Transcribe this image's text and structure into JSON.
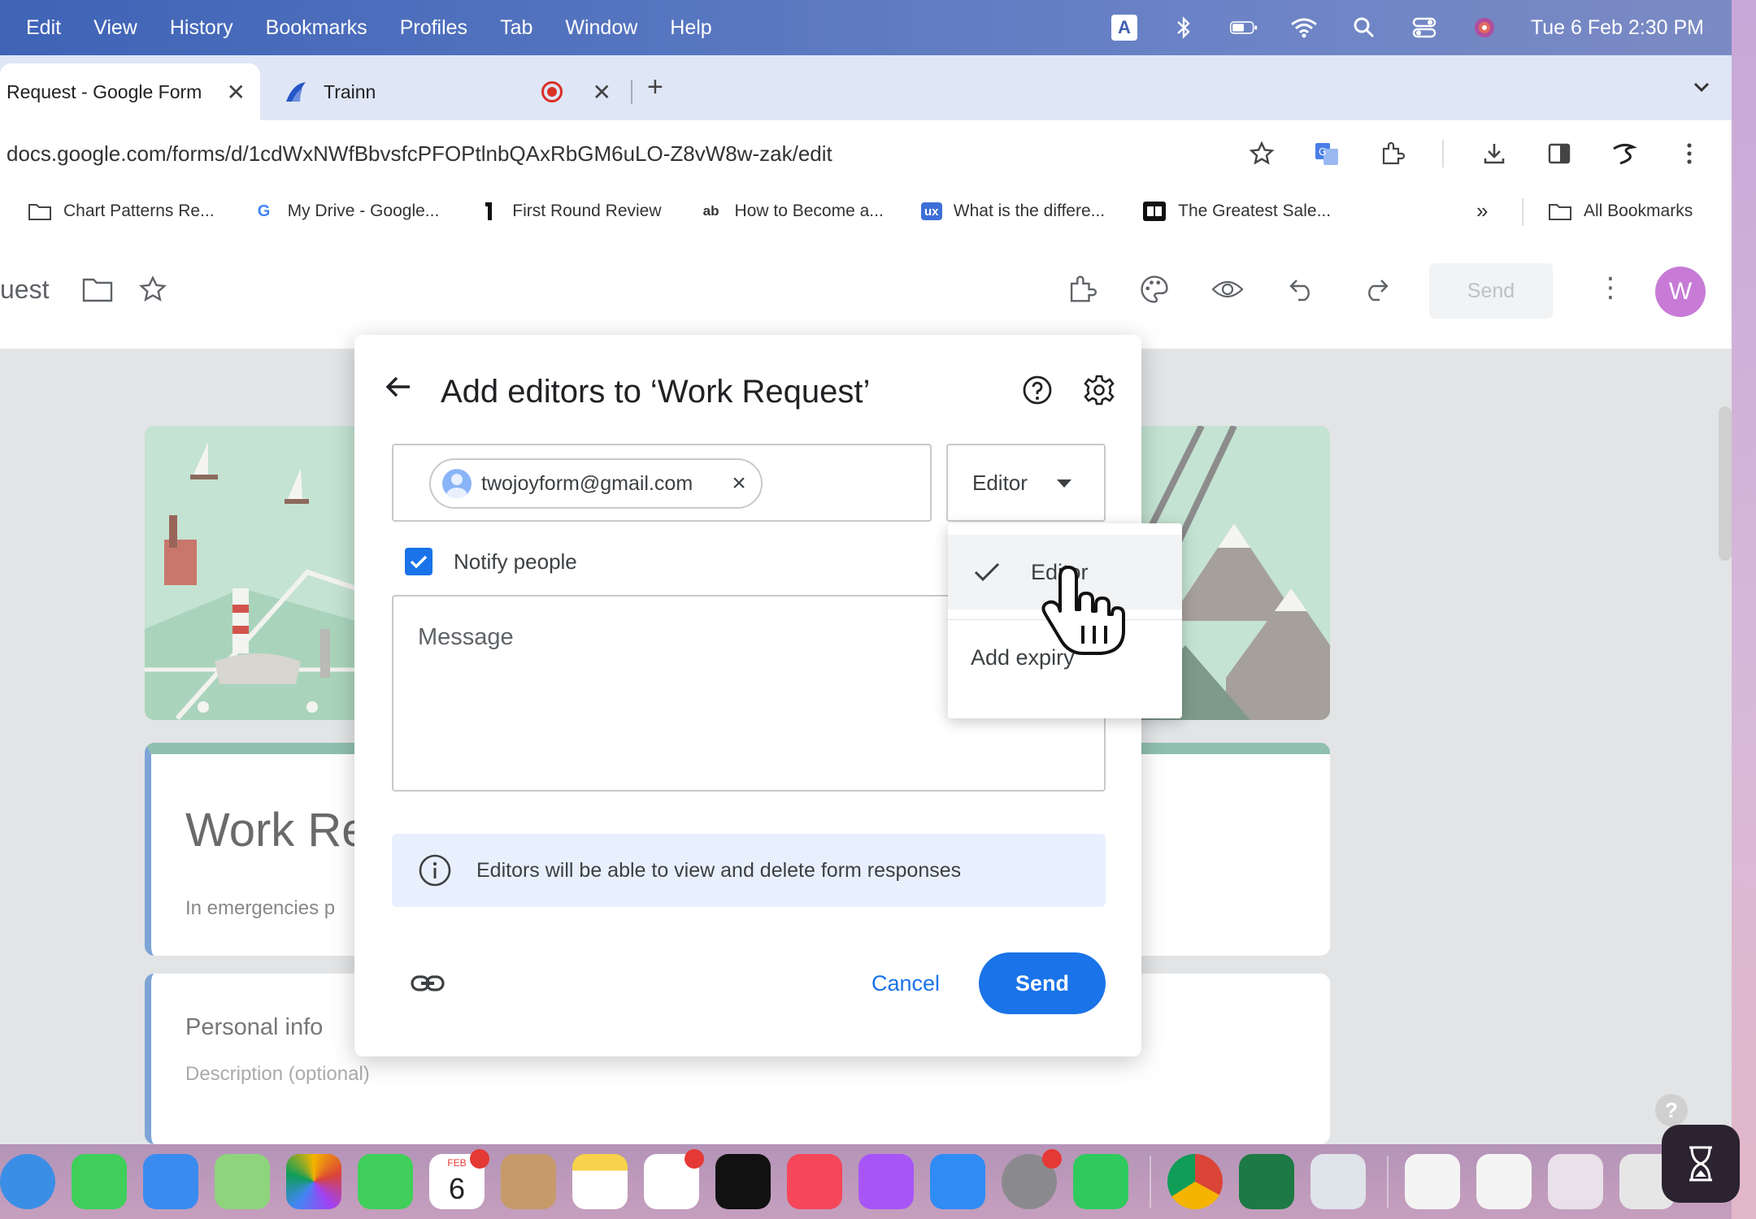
{
  "menubar": {
    "items": [
      "Edit",
      "View",
      "History",
      "Bookmarks",
      "Profiles",
      "Tab",
      "Window",
      "Help"
    ],
    "input_indicator": "A",
    "clock": "Tue 6 Feb  2:30 PM"
  },
  "tabs": [
    {
      "title": "Request - Google Form",
      "active": true
    },
    {
      "title": "Trainn",
      "active": false
    }
  ],
  "address_bar": {
    "url": "docs.google.com/forms/d/1cdWxNWfBbvsfcPFOPtlnbQAxRbGM6uLO-Z8vW8w-zak/edit"
  },
  "bookmarks": {
    "items": [
      {
        "label": "Chart Patterns Re...",
        "icon": "folder-icon"
      },
      {
        "label": "My Drive - Google...",
        "icon": "google-g-icon"
      },
      {
        "label": "First Round Review",
        "icon": "first-round-icon"
      },
      {
        "label": "How to Become a...",
        "icon": "ab-icon"
      },
      {
        "label": "What is the differe...",
        "icon": "ux-icon"
      },
      {
        "label": "The Greatest Sale...",
        "icon": "video-icon"
      }
    ],
    "all_label": "All Bookmarks"
  },
  "form_header": {
    "title": "uest",
    "send_label": "Send",
    "avatar_initial": "W"
  },
  "form": {
    "title": "Work Re",
    "description": "In emergencies p",
    "section_title": "Personal info",
    "section_description": "Description (optional)"
  },
  "dialog": {
    "title": "Add editors to ‘Work Request’",
    "recipient_email": "twojoyform@gmail.com",
    "role_label": "Editor",
    "notify_label": "Notify people",
    "notify_checked": true,
    "message_placeholder": "Message",
    "info_text": "Editors will be able to view and delete form responses",
    "cancel_label": "Cancel",
    "send_label": "Send"
  },
  "role_menu": {
    "options": [
      {
        "label": "Editor",
        "selected": true
      },
      {
        "label": "Add expiry",
        "selected": false
      }
    ]
  },
  "dock": {
    "calendar_day": "6",
    "calendar_month": "FEB"
  },
  "colors": {
    "accent": "#1a73e8",
    "info_bg": "#e8f0fe",
    "avatar": "#c77bd6",
    "menubar": "#4a6bbd"
  }
}
